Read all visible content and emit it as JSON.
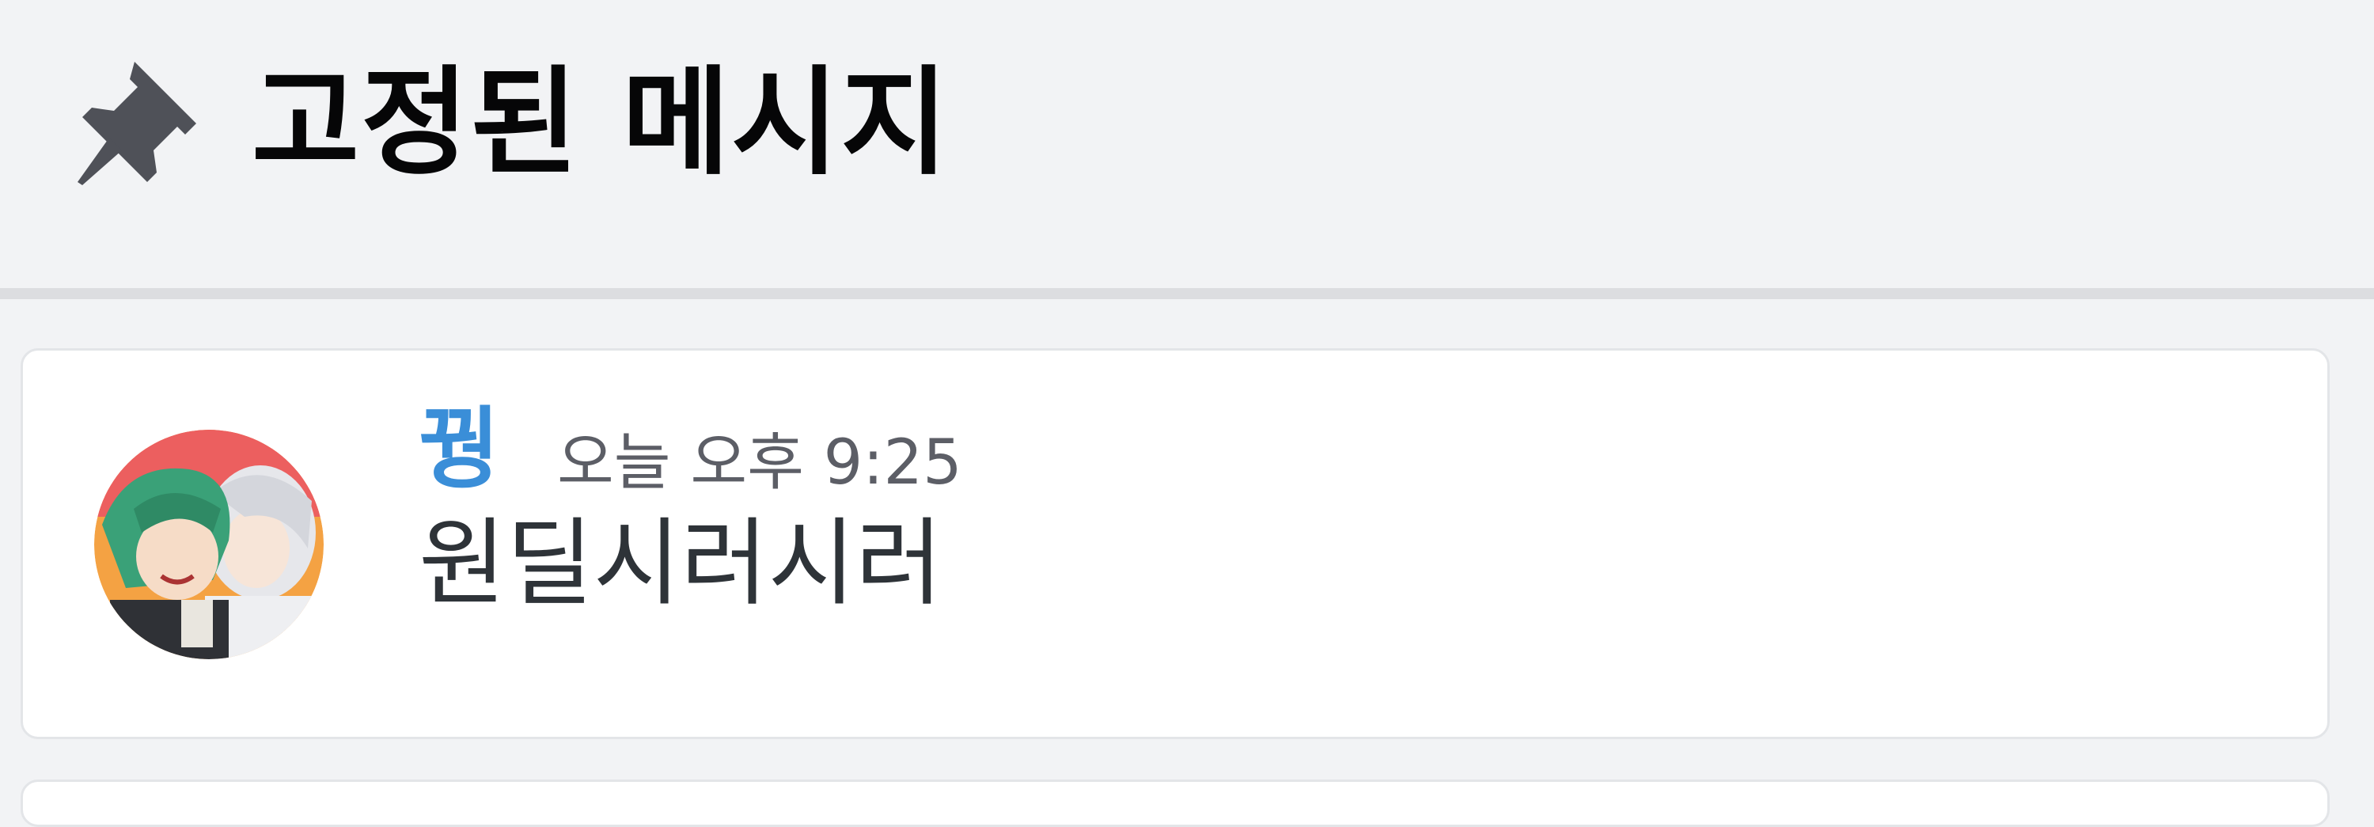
{
  "header": {
    "icon": "pin-icon",
    "title": "고정된 메시지"
  },
  "pinned_messages": [
    {
      "author": "꿩",
      "author_color": "#3a8ed8",
      "timestamp": "오늘 오후 9:25",
      "content": "원딜시러시러",
      "avatar": "anime-characters-avatar"
    }
  ],
  "colors": {
    "background": "#f2f3f5",
    "card": "#ffffff",
    "card_border": "#e3e5e8",
    "title_text": "#060607",
    "message_text": "#2e3338",
    "timestamp_text": "#5c5e66"
  }
}
